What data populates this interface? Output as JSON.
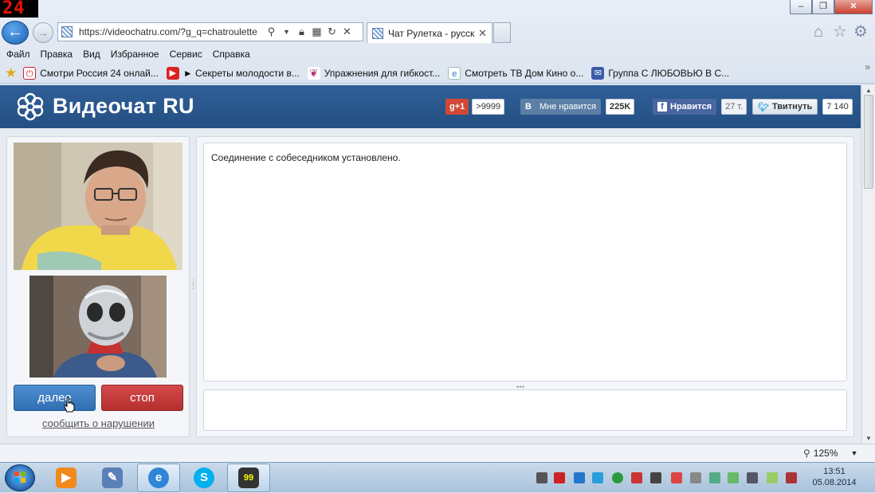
{
  "overlay": {
    "counter": "24"
  },
  "browser": {
    "url": "https://videochatru.com/?g_q=chatroulette",
    "tab_title": "Чат Рулетка - русск...",
    "menu": [
      "Файл",
      "Правка",
      "Вид",
      "Избранное",
      "Сервис",
      "Справка"
    ],
    "favorites": [
      {
        "label": "Смотри Россия 24 онлай...",
        "icon": "power-icon",
        "color": "#c23"
      },
      {
        "label": "► Секреты молодости в...",
        "icon": "youtube-icon",
        "color": "#d22"
      },
      {
        "label": "Упражнения для гибкост...",
        "icon": "pin-icon",
        "color": "#b0347a"
      },
      {
        "label": "Смотреть ТВ Дом Кино о...",
        "icon": "ie-page-icon",
        "color": "#2a78c7"
      },
      {
        "label": "Группа С ЛЮБОВЬЮ В С...",
        "icon": "group-icon",
        "color": "#3b5aa8"
      }
    ],
    "window_buttons": [
      "–",
      "❐",
      "✕"
    ]
  },
  "site": {
    "logo_text": "Видеочат RU",
    "social": {
      "gplus_label": "g+1",
      "gplus_count": ">9999",
      "vk_label": "Мне нравится",
      "vk_letter": "B",
      "vk_count": "225K",
      "fb_label": "Нравится",
      "fb_count": "27 т.",
      "tw_label": "Твитнуть",
      "tw_count": "7 140"
    },
    "next_button": "далее",
    "stop_button": "стоп",
    "report_link": "сообщить о нарушении",
    "chat_message": "Соединение с собеседником установлено."
  },
  "status": {
    "zoom": "125%"
  },
  "taskbar": {
    "time": "13:51",
    "date": "05.08.2014"
  },
  "colors": {
    "header": "#2f5f97",
    "next": "#3b7cc1",
    "stop": "#c63b3b"
  }
}
